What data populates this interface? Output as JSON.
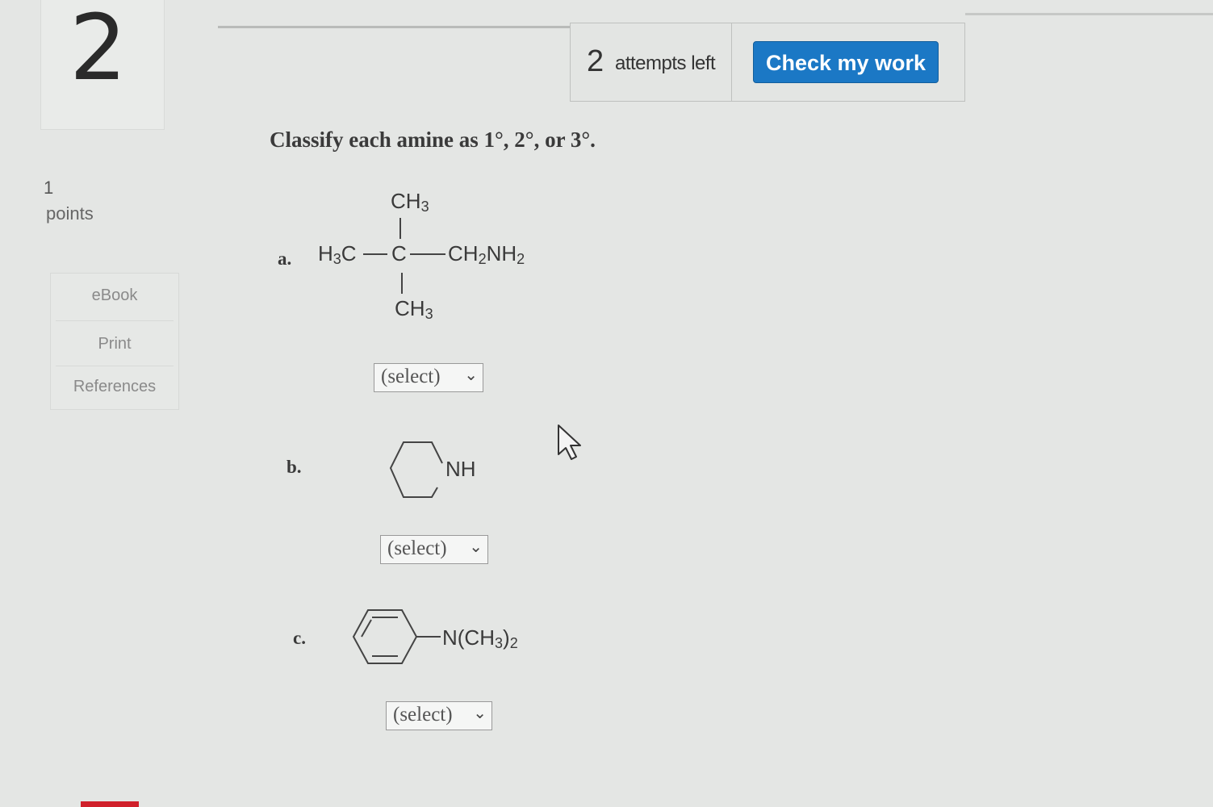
{
  "question": {
    "number": "2"
  },
  "toolbar": {
    "attempts_count": "2",
    "attempts_label": "attempts left",
    "check_label": "Check my work"
  },
  "points": {
    "value": "1",
    "label": "points"
  },
  "sidebar": {
    "items": [
      {
        "label": "eBook"
      },
      {
        "label": "Print"
      },
      {
        "label": "References"
      }
    ]
  },
  "prompt": "Classify each amine as 1°, 2°, or 3°.",
  "items": [
    {
      "label": "a.",
      "structure": {
        "top": "CH3",
        "left": "H3C",
        "center": "C",
        "right": "CH2NH2",
        "bottom": "CH3"
      },
      "select_value": "(select)"
    },
    {
      "label": "b.",
      "structure": {
        "heteroatom": "NH"
      },
      "select_value": "(select)"
    },
    {
      "label": "c.",
      "structure": {
        "substituent": "N(CH3)2"
      },
      "select_value": "(select)"
    }
  ],
  "colors": {
    "accent": "#1b78c5",
    "background": "#e4e6e4"
  }
}
